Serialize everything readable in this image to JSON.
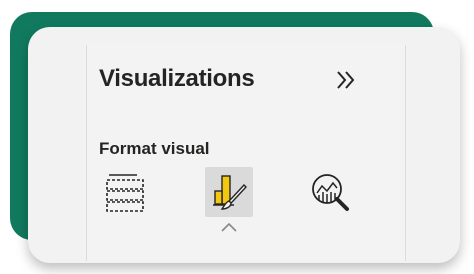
{
  "pane": {
    "title": "Visualizations",
    "subtitle": "Format visual",
    "collapse_icon": "chevron-double-right-icon"
  },
  "tabs": [
    {
      "id": "build",
      "icon": "build-visual-icon",
      "selected": false
    },
    {
      "id": "format",
      "icon": "format-visual-icon",
      "selected": true
    },
    {
      "id": "analytics",
      "icon": "analytics-icon",
      "selected": false
    }
  ],
  "colors": {
    "accent": "#117a5e",
    "format_icon_yellow": "#f2c811",
    "icon_stroke": "#252423"
  }
}
